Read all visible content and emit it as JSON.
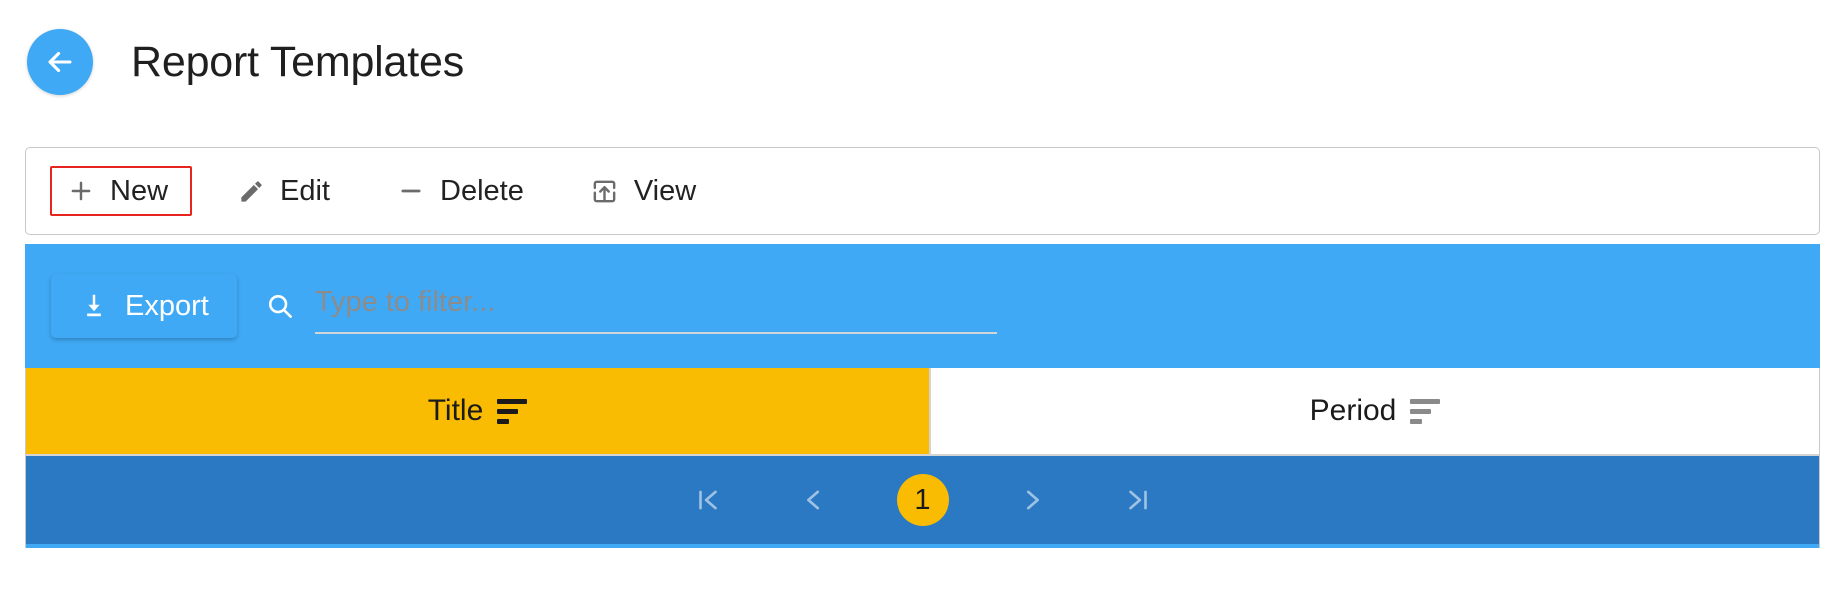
{
  "header": {
    "back_icon": "arrow-left-icon",
    "title": "Report Templates",
    "accent_color": "#3FA9F5"
  },
  "toolbar": {
    "items": [
      {
        "label": "New",
        "icon": "plus-icon",
        "highlighted": true
      },
      {
        "label": "Edit",
        "icon": "pencil-icon",
        "highlighted": false
      },
      {
        "label": "Delete",
        "icon": "minus-icon",
        "highlighted": false
      },
      {
        "label": "View",
        "icon": "launch-box-icon",
        "highlighted": false
      }
    ],
    "highlight_color": "#e8241f"
  },
  "filter_bar": {
    "background_color": "#3FA9F5",
    "export_label": "Export",
    "export_icon": "download-icon",
    "search_icon": "search-icon",
    "filter_placeholder": "Type to filter...",
    "filter_value": ""
  },
  "table": {
    "columns": [
      {
        "label": "Title",
        "sort_icon": "sort-descending-icon",
        "active": true,
        "background_color": "#FABC02"
      },
      {
        "label": "Period",
        "sort_icon": "sort-descending-icon",
        "active": false,
        "background_color": "#FFFFFF"
      }
    ],
    "rows": []
  },
  "pagination": {
    "background_color": "#2B79C2",
    "first_label": "|<",
    "prev_label": "<",
    "current_page": "1",
    "next_label": ">",
    "last_label": ">|",
    "current_page_color": "#FABC02"
  }
}
